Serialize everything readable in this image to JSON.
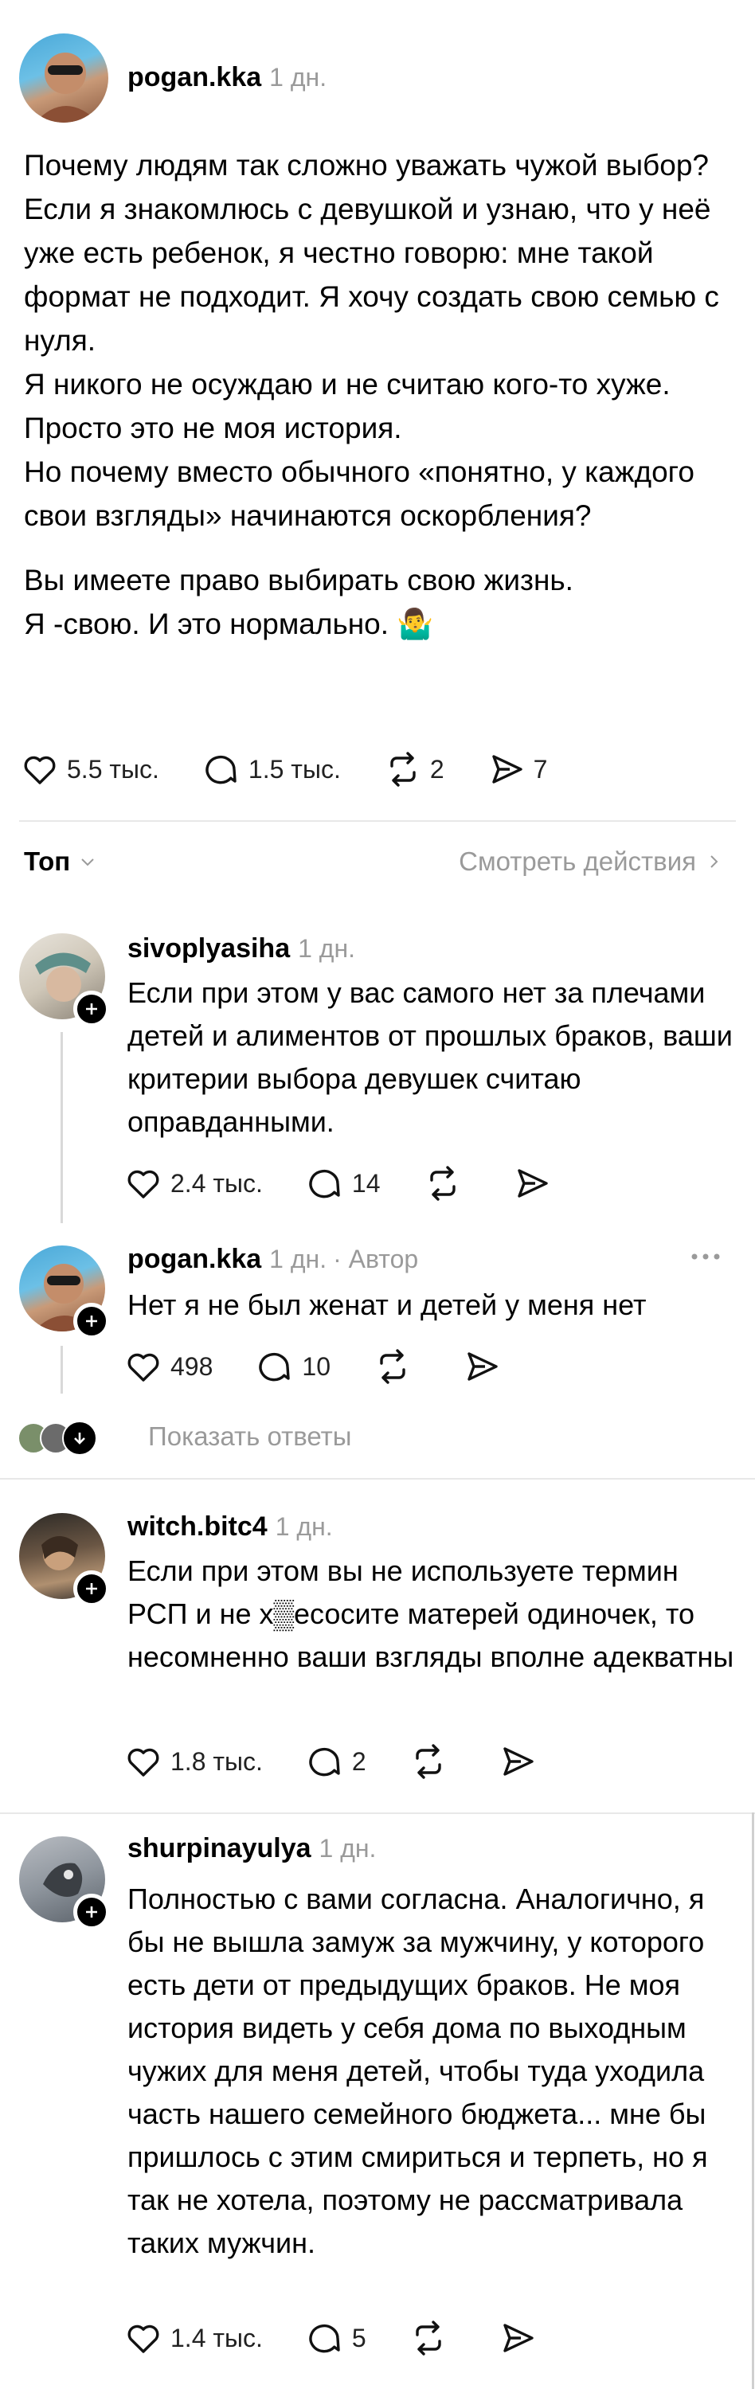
{
  "post": {
    "username": "pogan.kka",
    "time": "1 дн.",
    "paragraphs": [
      "Почему людям так сложно уважать чужой выбор?",
      "Если я знакомлюсь с девушкой и узнаю, что у неё уже есть ребенок, я честно говорю: мне такой формат не подходит. Я хочу создать свою семью с нуля.",
      "Я никого не осуждаю и не считаю кого-то хуже. Просто это не моя история.",
      "Но почему вместо обычного «понятно, у каждого свои взгляды» начинаются оскорбления?",
      "Вы имеете право выбирать свою жизнь.",
      "Я -свою. И это нормально. 🤷‍♂️"
    ],
    "likes": "5.5 тыс.",
    "replies": "1.5 тыс.",
    "reposts": "2",
    "shares": "7"
  },
  "sort": {
    "label": "Топ",
    "activity_link": "Смотреть действия"
  },
  "comments": [
    {
      "username": "sivoplyasiha",
      "time": "1 дн.",
      "author_tag": "",
      "text": "Если при этом у вас самого нет за плечами детей и алиментов  от прошлых браков, ваши критерии выбора девушек считаю оправданными.",
      "likes": "2.4 тыс.",
      "replies": "14"
    },
    {
      "username": "pogan.kka",
      "time": "1 дн.",
      "author_tag": "· Автор",
      "text": "Нет я не был женат и детей у меня нет",
      "likes": "498",
      "replies": "10"
    },
    {
      "username": "witch.bitc4",
      "time": "1 дн.",
      "author_tag": "",
      "text": "Если при этом вы не используете термин РСП и не х▒есосите матерей одиночек, то несомненно ваши взгляды вполне адекватны",
      "likes": "1.8 тыс.",
      "replies": "2"
    },
    {
      "username": "shurpinayulya",
      "time": "1 дн.",
      "author_tag": "",
      "text": "Полностью с вами согласна. Аналогично, я бы не вышла замуж за мужчину, у которого есть дети от предыдущих браков. Не моя история видеть у себя дома по выходным чужих для меня детей, чтобы туда уходила часть нашего семейного бюджета... мне бы пришлось с этим смириться и терпеть, но я так не хотела, поэтому не рассматривала таких мужчин.",
      "likes": "1.4 тыс.",
      "replies": "5"
    }
  ],
  "show_replies": "Показать ответы",
  "more_icon": "ellipsis-icon",
  "colors": {
    "secondary": "#9a9a9a",
    "divider": "#e8e8e8",
    "accent": "#000000"
  }
}
